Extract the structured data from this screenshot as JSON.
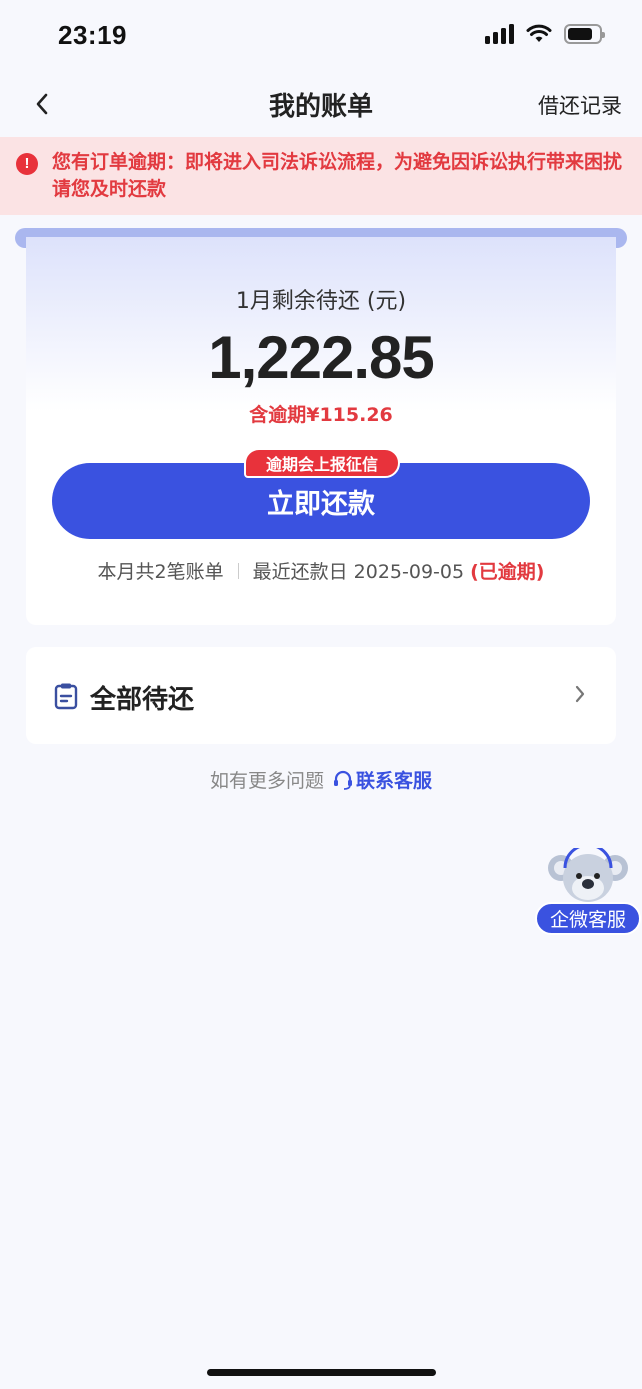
{
  "status_bar": {
    "time": "23:19"
  },
  "nav": {
    "title": "我的账单",
    "right_link": "借还记录"
  },
  "alert": {
    "text": "您有订单逾期：即将进入司法诉讼流程，为避免因诉讼执行带来困扰请您及时还款"
  },
  "summary": {
    "remaining_label": "1月剩余待还 (元)",
    "amount": "1,222.85",
    "overdue_amount": "含逾期¥115.26",
    "credit_badge": "逾期会上报征信",
    "pay_button": "立即还款",
    "bill_count": "本月共2笔账单",
    "recent_date_label": "最近还款日 2025-09-05",
    "overdue_tag": "(已逾期)"
  },
  "all_pending": {
    "label": "全部待还"
  },
  "help": {
    "question": "如有更多问题",
    "contact": "联系客服"
  },
  "wecom": {
    "label": "企微客服"
  },
  "colors": {
    "accent": "#3a52e0",
    "danger": "#e23a40",
    "alert_bg": "#fbe3e4"
  },
  "icons": [
    "back-chevron-icon",
    "alert-exclamation-icon",
    "clipboard-icon",
    "chevron-right-icon",
    "headset-icon",
    "koala-mascot-icon"
  ]
}
